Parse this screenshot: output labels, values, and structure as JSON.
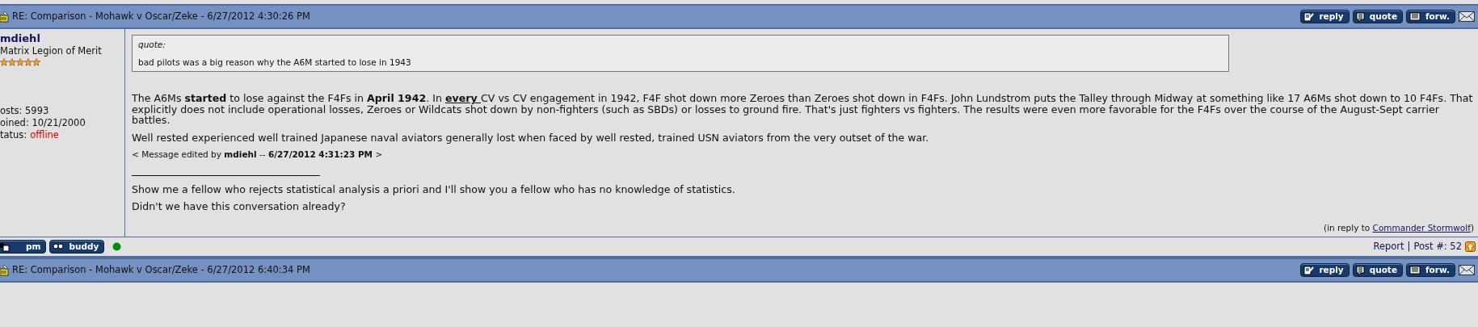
{
  "post": {
    "title": "RE: Comparison - Mohawk v Oscar/Zeke - 6/27/2012 4:30:26 PM",
    "header_buttons": [
      "reply",
      "quote",
      "forw."
    ],
    "author": {
      "name": "mdiehl",
      "rank": "Matrix Legion of Merit",
      "stars": 5,
      "posts": "osts: 5993",
      "joined": "oined: 10/21/2000",
      "status_label": "tatus:",
      "status": "offline",
      "online": false
    },
    "quote": {
      "label": "quote:",
      "text": "bad pilots was a big reason why the A6M started to lose in 1943"
    },
    "paragraphs": [
      [
        {
          "kind": "plain",
          "text": "The A6Ms "
        },
        {
          "kind": "bold",
          "text": "started"
        },
        {
          "kind": "plain",
          "text": " to lose against the F4Fs in "
        },
        {
          "kind": "bold",
          "text": "April 1942"
        },
        {
          "kind": "plain",
          "text": ". In "
        },
        {
          "kind": "bold-underline",
          "text": "every "
        },
        {
          "kind": "plain",
          "text": "CV vs CV engagement in 1942, F4F shot down more Zeroes than Zeroes shot down in F4Fs. John Lundstrom puts the Talley through Midway at something like 17 A6Ms shot down to 10 F4Fs. That explicitly does not include operational losses, Zeroes or Wildcats shot down by non-fighters (such as SBDs) or losses to ground fire. That's just fighters vs fighters. The results were even more favorable for the F4Fs over the course of the August-Sept carrier battles."
        }
      ],
      [
        {
          "kind": "plain",
          "text": "Well rested experienced well trained Japanese naval aviators generally lost when faced by well rested, trained USN aviators from the very outset of the war."
        }
      ]
    ],
    "edit_note": "< Message edited by **mdiehl** -- **6/27/2012 4:31:23 PM** >",
    "signature": [
      "Show me a fellow who rejects statistical analysis a priori and I'll show you a fellow who has no knowledge of statistics.",
      "Didn't we have this conversation already?"
    ],
    "reply_to": {
      "prefix": "(in reply to ",
      "name": "Commander Stormwolf",
      "suffix": ")"
    },
    "footer_buttons": [
      "pm",
      "buddy"
    ],
    "report_link": "Report",
    "separator": "|",
    "post_number": "Post #: 52"
  },
  "next_post": {
    "title": "RE: Comparison - Mohawk v Oscar/Zeke - 6/27/2012 6:40:34 PM",
    "header_buttons": [
      "reply",
      "quote",
      "forw."
    ]
  }
}
